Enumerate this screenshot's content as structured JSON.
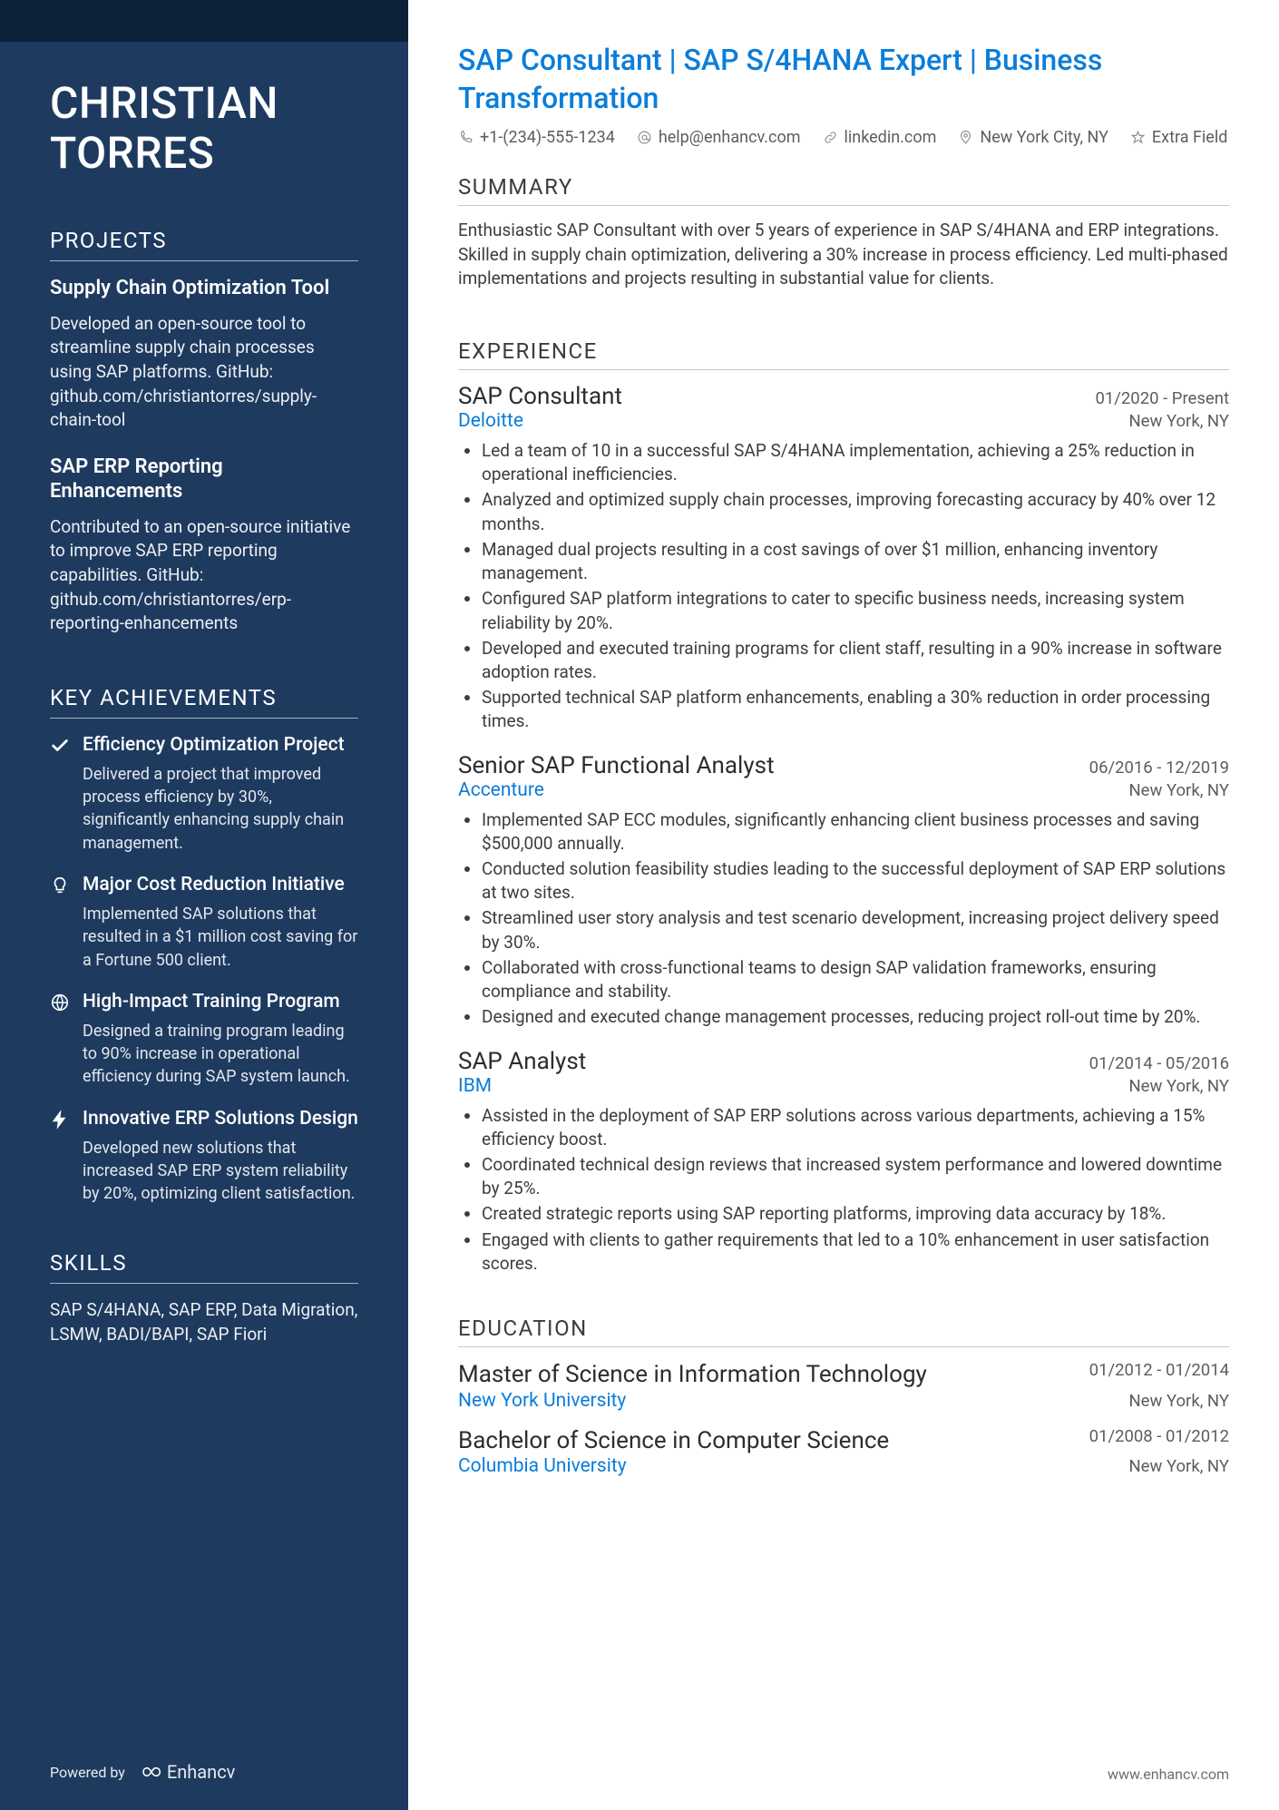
{
  "name_first": "CHRISTIAN",
  "name_last": "TORRES",
  "headline": "SAP Consultant | SAP S/4HANA Expert | Business Transformation",
  "contacts": {
    "phone": "+1-(234)-555-1234",
    "email": "help@enhancv.com",
    "linkedin": "linkedin.com",
    "location": "New York City, NY",
    "extra": "Extra Field"
  },
  "summary_title": "SUMMARY",
  "summary": "Enthusiastic SAP Consultant with over 5 years of experience in SAP S/4HANA and ERP integrations. Skilled in supply chain optimization, delivering a 30% increase in process efficiency. Led multi-phased implementations and projects resulting in substantial value for clients.",
  "experience_title": "EXPERIENCE",
  "jobs": [
    {
      "title": "SAP Consultant",
      "dates": "01/2020 - Present",
      "company": "Deloitte",
      "location": "New York, NY",
      "bullets": [
        "Led a team of 10 in a successful SAP S/4HANA implementation, achieving a 25% reduction in operational inefficiencies.",
        "Analyzed and optimized supply chain processes, improving forecasting accuracy by 40% over 12 months.",
        "Managed dual projects resulting in a cost savings of over $1 million, enhancing inventory management.",
        "Configured SAP platform integrations to cater to specific business needs, increasing system reliability by 20%.",
        "Developed and executed training programs for client staff, resulting in a 90% increase in software adoption rates.",
        "Supported technical SAP platform enhancements, enabling a 30% reduction in order processing times."
      ]
    },
    {
      "title": "Senior SAP Functional Analyst",
      "dates": "06/2016 - 12/2019",
      "company": "Accenture",
      "location": "New York, NY",
      "bullets": [
        "Implemented SAP ECC modules, significantly enhancing client business processes and saving $500,000 annually.",
        "Conducted solution feasibility studies leading to the successful deployment of SAP ERP solutions at two sites.",
        "Streamlined user story analysis and test scenario development, increasing project delivery speed by 30%.",
        "Collaborated with cross-functional teams to design SAP validation frameworks, ensuring compliance and stability.",
        "Designed and executed change management processes, reducing project roll-out time by 20%."
      ]
    },
    {
      "title": "SAP Analyst",
      "dates": "01/2014 - 05/2016",
      "company": "IBM",
      "location": "New York, NY",
      "bullets": [
        "Assisted in the deployment of SAP ERP solutions across various departments, achieving a 15% efficiency boost.",
        "Coordinated technical design reviews that increased system performance and lowered downtime by 25%.",
        "Created strategic reports using SAP reporting platforms, improving data accuracy by 18%.",
        "Engaged with clients to gather requirements that led to a 10% enhancement in user satisfaction scores."
      ]
    }
  ],
  "education_title": "EDUCATION",
  "education": [
    {
      "degree": "Master of Science in Information Technology",
      "dates": "01/2012 - 01/2014",
      "school": "New York University",
      "location": "New York, NY"
    },
    {
      "degree": "Bachelor of Science in Computer Science",
      "dates": "01/2008 - 01/2012",
      "school": "Columbia University",
      "location": "New York, NY"
    }
  ],
  "projects_title": "PROJECTS",
  "projects": [
    {
      "title": "Supply Chain Optimization Tool",
      "desc": "Developed an open-source tool to streamline supply chain processes using SAP platforms. GitHub: github.com/christiantorres/supply-chain-tool"
    },
    {
      "title": "SAP ERP Reporting Enhancements",
      "desc": "Contributed to an open-source initiative to improve SAP ERP reporting capabilities. GitHub: github.com/christiantorres/erp-reporting-enhancements"
    }
  ],
  "achievements_title": "KEY ACHIEVEMENTS",
  "achievements": [
    {
      "title": "Efficiency Optimization Project",
      "desc": "Delivered a project that improved process efficiency by 30%, significantly enhancing supply chain management."
    },
    {
      "title": "Major Cost Reduction Initiative",
      "desc": "Implemented SAP solutions that resulted in a $1 million cost saving for a Fortune 500 client."
    },
    {
      "title": "High-Impact Training Program",
      "desc": "Designed a training program leading to 90% increase in operational efficiency during SAP system launch."
    },
    {
      "title": "Innovative ERP Solutions Design",
      "desc": "Developed new solutions that increased SAP ERP system reliability by 20%, optimizing client satisfaction."
    }
  ],
  "skills_title": "SKILLS",
  "skills": "SAP S/4HANA, SAP ERP, Data Migration, LSMW, BADI/BAPI, SAP Fiori",
  "footer": {
    "powered": "Powered by",
    "brand": "Enhancv",
    "url": "www.enhancv.com"
  }
}
